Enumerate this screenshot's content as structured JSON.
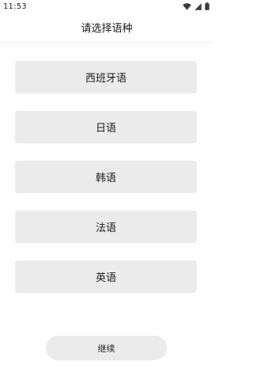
{
  "status_bar": {
    "time": "11:53",
    "icons": [
      "wifi-icon",
      "signal-icon",
      "battery-icon"
    ]
  },
  "header": {
    "title": "请选择语种"
  },
  "languages": [
    {
      "label": "西班牙语"
    },
    {
      "label": "日语"
    },
    {
      "label": "韩语"
    },
    {
      "label": "法语"
    },
    {
      "label": "英语"
    }
  ],
  "continue_label": "继续",
  "colors": {
    "option_bg": "#ebebeb",
    "text": "#1a1a1a",
    "background": "#ffffff"
  }
}
